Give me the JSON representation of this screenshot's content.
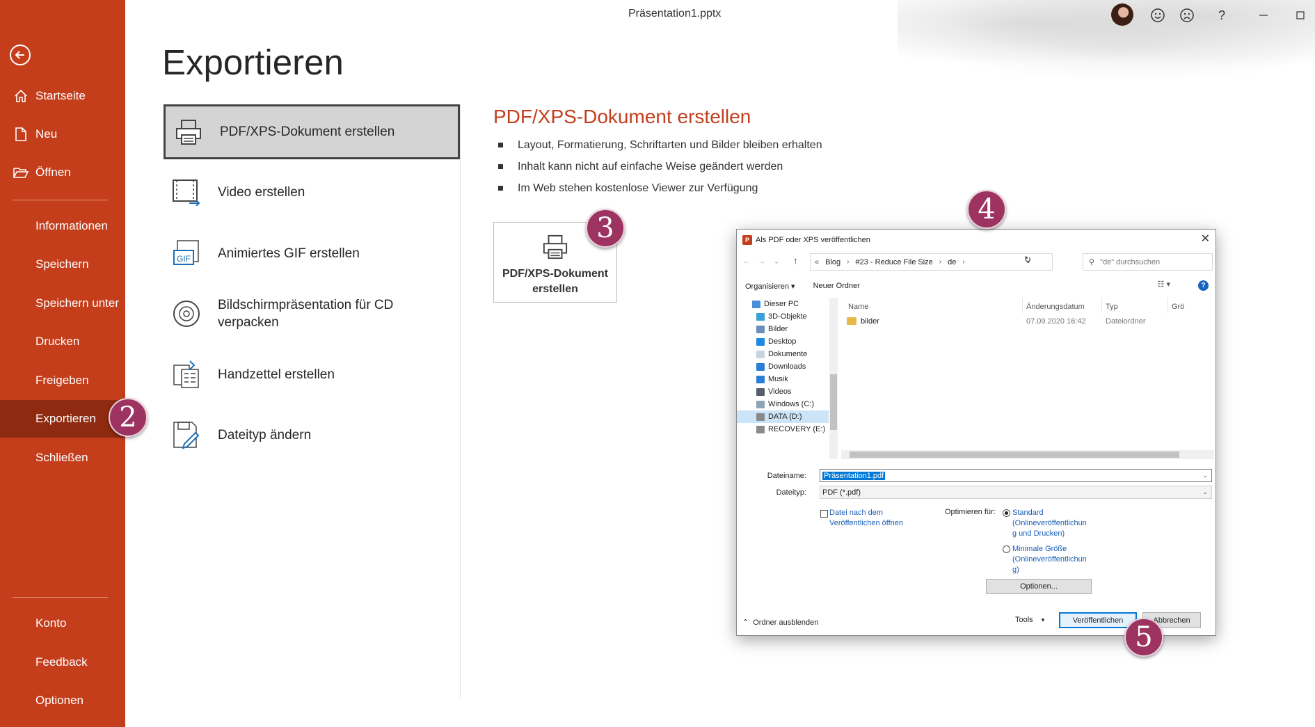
{
  "window": {
    "doc_title": "Präsentation1.pptx",
    "top_icons": [
      "smiley-icon",
      "frown-icon",
      "help-icon",
      "minimize-icon"
    ],
    "help_glyph": "?"
  },
  "sidebar": {
    "items": [
      {
        "label": "Startseite",
        "icon": "home-icon"
      },
      {
        "label": "Neu",
        "icon": "new-file-icon"
      },
      {
        "label": "Öffnen",
        "icon": "open-folder-icon"
      },
      {
        "label": "Informationen"
      },
      {
        "label": "Speichern"
      },
      {
        "label": "Speichern unter"
      },
      {
        "label": "Drucken"
      },
      {
        "label": "Freigeben"
      },
      {
        "label": "Exportieren"
      },
      {
        "label": "Schließen"
      },
      {
        "label": "Konto"
      },
      {
        "label": "Feedback"
      },
      {
        "label": "Optionen"
      }
    ],
    "active": "Exportieren",
    "accent_color": "#c43e1c"
  },
  "main": {
    "title": "Exportieren",
    "export_options": [
      {
        "label": "PDF/XPS-Dokument erstellen",
        "icon": "pdf-printer-icon"
      },
      {
        "label": "Video erstellen",
        "icon": "video-icon"
      },
      {
        "label": "Animiertes GIF erstellen",
        "icon": "gif-icon",
        "icon_text": "GIF"
      },
      {
        "label": "Bildschirmpräsentation für CD verpacken",
        "icon": "cd-icon"
      },
      {
        "label": "Handzettel erstellen",
        "icon": "handout-icon"
      },
      {
        "label": "Dateityp ändern",
        "icon": "change-filetype-icon"
      }
    ],
    "detail": {
      "title": "PDF/XPS-Dokument erstellen",
      "bullets": [
        "Layout, Formatierung, Schriftarten und Bilder bleiben erhalten",
        "Inhalt kann nicht auf einfache Weise geändert werden",
        "Im Web stehen kostenlose Viewer zur Verfügung"
      ],
      "create_button": "PDF/XPS-Dokument erstellen"
    }
  },
  "markers": [
    "2",
    "3",
    "4",
    "5"
  ],
  "dialog": {
    "title": "Als PDF oder XPS veröffentlichen",
    "close_glyph": "✕",
    "breadcrumb": [
      "Blog",
      "#23 - Reduce File Size",
      "de"
    ],
    "breadcrumb_prefix": "«",
    "search_placeholder": "\"de\" durchsuchen",
    "organize": "Organisieren ▾",
    "new_folder": "Neuer Ordner",
    "help_glyph": "?",
    "tree": [
      "Dieser PC",
      "3D-Objekte",
      "Bilder",
      "Desktop",
      "Dokumente",
      "Downloads",
      "Musik",
      "Videos",
      "Windows (C:)",
      "DATA (D:)",
      "RECOVERY (E:)"
    ],
    "tree_selected": "DATA (D:)",
    "columns": [
      "Name",
      "Änderungsdatum",
      "Typ",
      "Grö"
    ],
    "files": [
      {
        "name": "bilder",
        "date": "07.09.2020 16:42",
        "type": "Dateiordner"
      }
    ],
    "filename_label": "Dateiname:",
    "filename_value": "Präsentation1.pdf",
    "filetype_label": "Dateityp:",
    "filetype_value": "PDF (*.pdf)",
    "open_after_line1": "Datei nach dem",
    "open_after_line2": "Veröffentlichen öffnen",
    "optimize_label": "Optimieren für:",
    "radio_standard": [
      "Standard",
      "(Onlineveröffentlichun",
      "g und Drucken)"
    ],
    "radio_minimal": [
      "Minimale Größe",
      "(Onlineveröffentlichun",
      "g)"
    ],
    "options_button": "Optionen...",
    "hide_folders": "Ordner ausblenden",
    "tools": "Tools",
    "publish_button": "Veröffentlichen",
    "cancel_button": "Abbrechen"
  }
}
